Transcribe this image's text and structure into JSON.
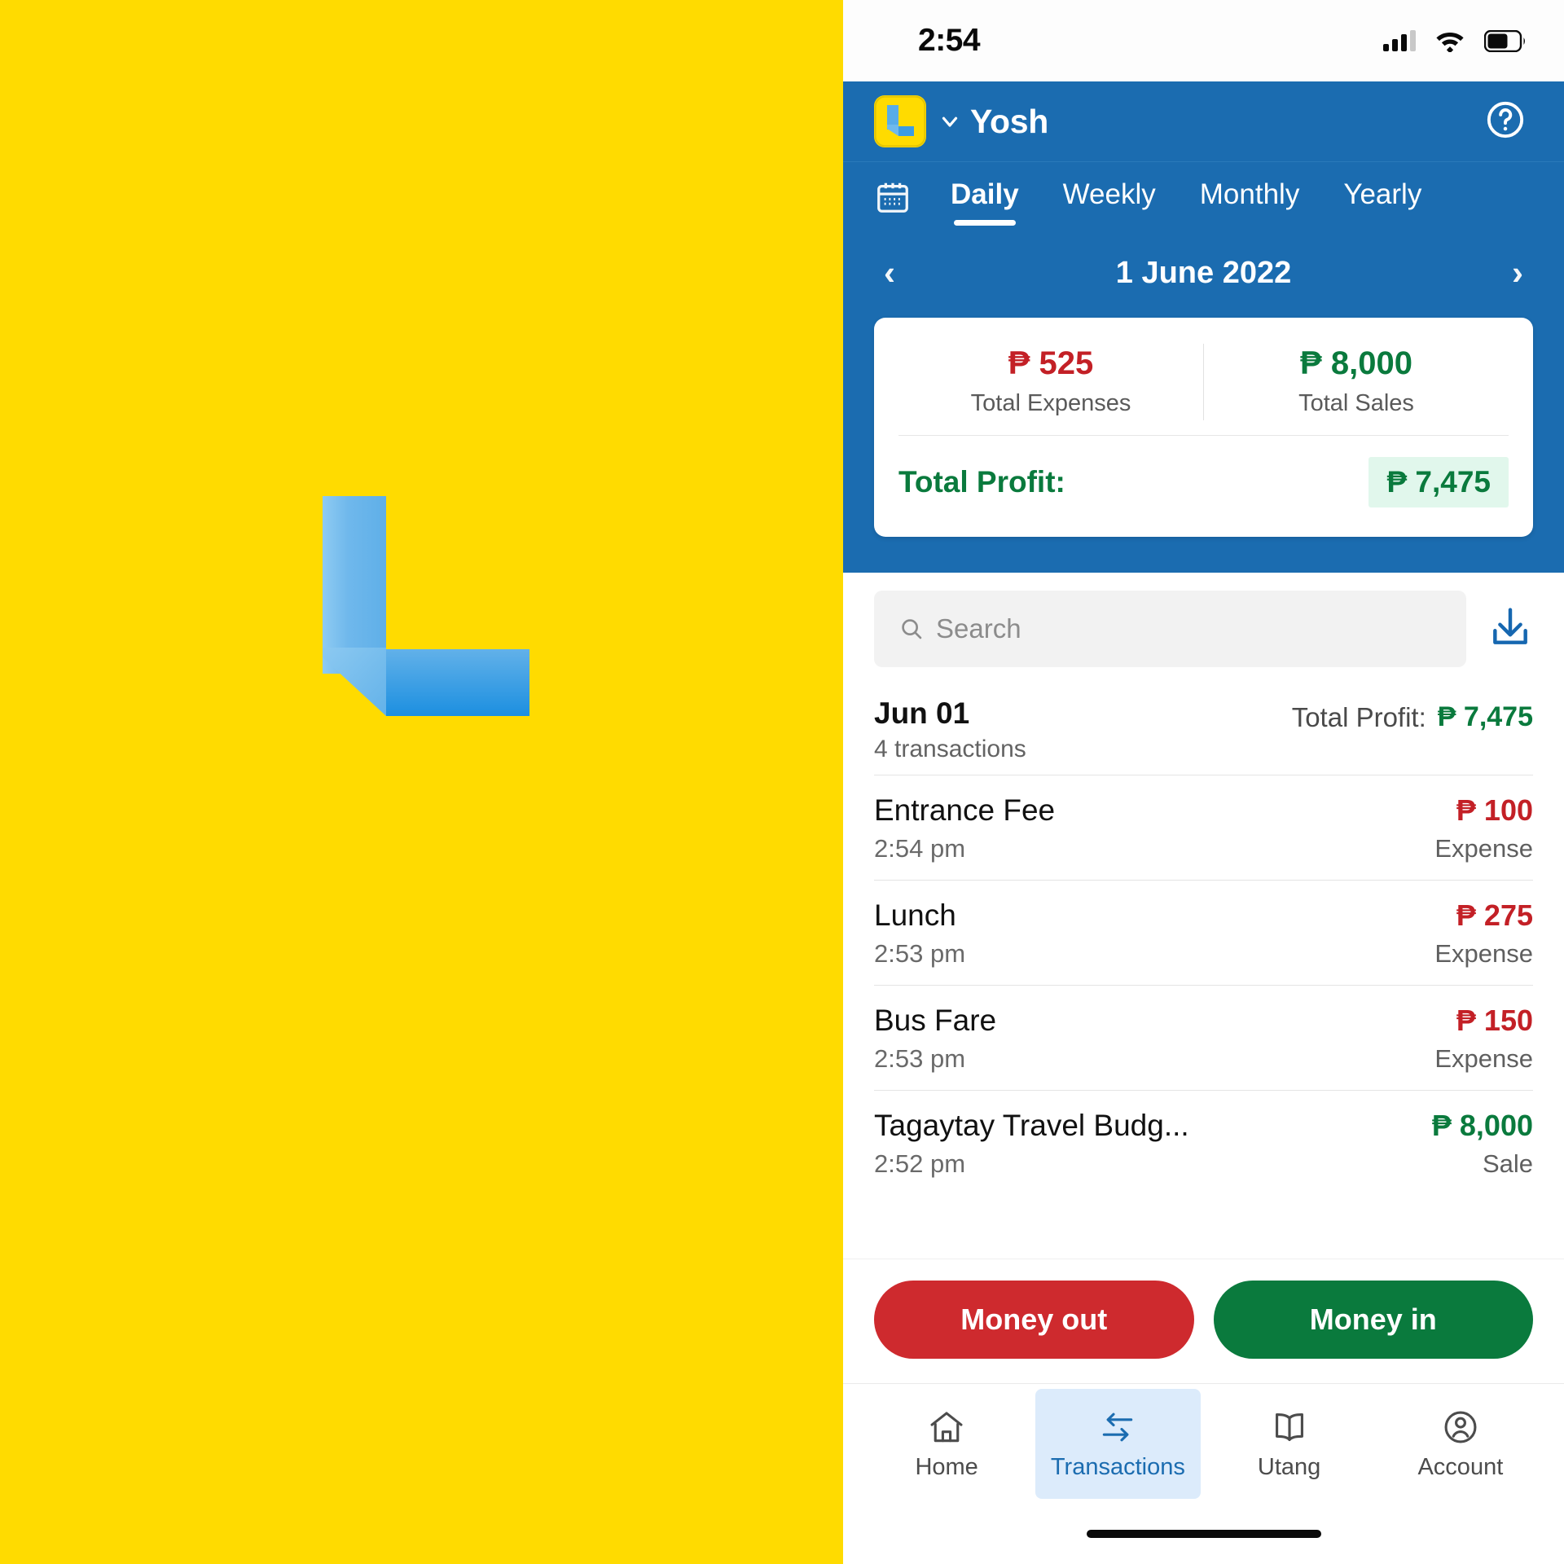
{
  "brand": {
    "logo_letter": "L",
    "panel_color": "#FFDB00",
    "logo_color": "#58ACE8"
  },
  "status_bar": {
    "time": "2:54",
    "signal_icon": "signal-bars-icon",
    "wifi_icon": "wifi-icon",
    "battery_icon": "battery-icon",
    "signal_bars_filled": 3,
    "signal_bars_total": 4,
    "battery_level_pct": 62
  },
  "header": {
    "app_icon_name": "app-logo-icon",
    "account_name": "Yosh",
    "caret_icon": "chevron-down-icon",
    "help_icon": "help-circle-icon",
    "background_color": "#1B6CB0"
  },
  "period_tabs": {
    "calendar_icon": "calendar-icon",
    "items": [
      {
        "label": "Daily",
        "active": true
      },
      {
        "label": "Weekly",
        "active": false
      },
      {
        "label": "Monthly",
        "active": false
      },
      {
        "label": "Yearly",
        "active": false
      }
    ]
  },
  "date_nav": {
    "prev_icon": "chevron-left-icon",
    "next_icon": "chevron-right-icon",
    "date_label": "1 June 2022"
  },
  "summary_card": {
    "expenses": {
      "amount": "₱ 525",
      "label": "Total Expenses",
      "color": "#C32026"
    },
    "sales": {
      "amount": "₱ 8,000",
      "label": "Total Sales",
      "color": "#0A7A3D"
    },
    "profit": {
      "label": "Total Profit:",
      "value": "₱ 7,475",
      "color": "#0A7A3D",
      "chip_bg": "#E1F7EC"
    }
  },
  "search": {
    "placeholder": "Search",
    "value": "",
    "search_icon": "search-icon",
    "download_icon": "download-icon"
  },
  "day_group": {
    "date": "Jun 01",
    "transaction_count": "4 transactions",
    "profit_label": "Total Profit:",
    "profit_value": "₱ 7,475"
  },
  "transactions": [
    {
      "title": "Entrance Fee",
      "time": "2:54 pm",
      "amount": "₱ 100",
      "type": "Expense",
      "kind": "expense"
    },
    {
      "title": "Lunch",
      "time": "2:53 pm",
      "amount": "₱ 275",
      "type": "Expense",
      "kind": "expense"
    },
    {
      "title": "Bus Fare",
      "time": "2:53 pm",
      "amount": "₱ 150",
      "type": "Expense",
      "kind": "expense"
    },
    {
      "title": "Tagaytay Travel Budg...",
      "time": "2:52 pm",
      "amount": "₱ 8,000",
      "type": "Sale",
      "kind": "sale"
    }
  ],
  "actions": {
    "money_out": {
      "label": "Money out",
      "color": "#CE2A2E"
    },
    "money_in": {
      "label": "Money in",
      "color": "#0A7A3D"
    }
  },
  "bottom_nav": {
    "items": [
      {
        "label": "Home",
        "icon": "home-icon",
        "active": false
      },
      {
        "label": "Transactions",
        "icon": "transfer-icon",
        "active": true
      },
      {
        "label": "Utang",
        "icon": "book-icon",
        "active": false
      },
      {
        "label": "Account",
        "icon": "user-circle-icon",
        "active": false
      }
    ]
  }
}
